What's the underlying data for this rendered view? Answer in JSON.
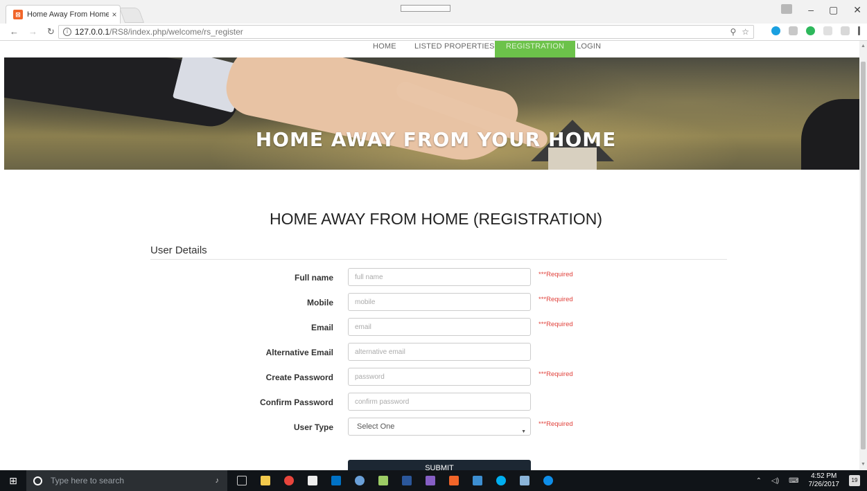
{
  "browser": {
    "tab_title": "Home Away From Home",
    "tab_close": "×",
    "url_host": "127.0.0.1",
    "url_path": "/RS8/index.php/welcome/rs_register",
    "win_min": "–",
    "win_max": "▢",
    "win_close": "✕"
  },
  "nav": {
    "home": "HOME",
    "listed": "LISTED PROPERTIES",
    "registration": "REGISTRATION",
    "login": "LOGIN"
  },
  "hero": {
    "title": "HOME AWAY FROM YOUR HOME"
  },
  "form": {
    "title": "HOME AWAY FROM HOME (REGISTRATION)",
    "section": "User Details",
    "required": "***Required",
    "fields": {
      "fullname": {
        "label": "Full name",
        "placeholder": "full name"
      },
      "mobile": {
        "label": "Mobile",
        "placeholder": "mobile"
      },
      "email": {
        "label": "Email",
        "placeholder": "email"
      },
      "altemail": {
        "label": "Alternative Email",
        "placeholder": "alternative email"
      },
      "password": {
        "label": "Create Password",
        "placeholder": "password"
      },
      "confirm": {
        "label": "Confirm Password",
        "placeholder": "confirm password"
      },
      "usertype": {
        "label": "User Type",
        "value": "Select One"
      }
    },
    "submit": "SUBMIT"
  },
  "taskbar": {
    "search_placeholder": "Type here to search",
    "time": "4:52 PM",
    "date": "7/26/2017",
    "notifications": "19"
  },
  "colors": {
    "nav_active": "#6cc24a",
    "required_text": "#e0403a",
    "submit_bg": "#1c2733"
  }
}
